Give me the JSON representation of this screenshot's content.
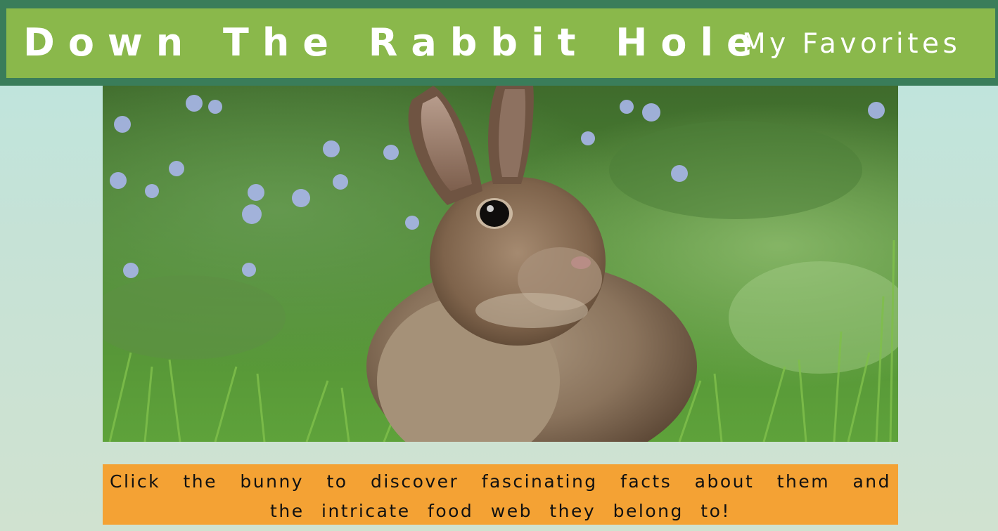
{
  "header": {
    "title": "Down The Rabbit Hole",
    "nav_favorites": "My Favorites"
  },
  "hero": {
    "image_subject": "bunny-photo"
  },
  "caption": {
    "text": "Click the bunny to discover fascinating facts about them and the intricate food web they belong to!"
  },
  "colors": {
    "header_border": "#3a7d5a",
    "header_bg": "#8ab84b",
    "caption_bg": "#f4a234",
    "page_bg_top": "#bde6e0",
    "page_bg_bottom": "#d0e2d0"
  }
}
